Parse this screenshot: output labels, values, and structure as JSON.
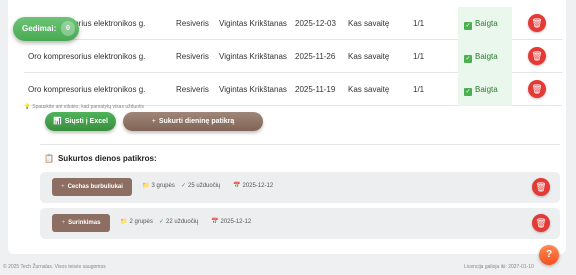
{
  "tasks": [
    {
      "component": "Oro kompresorius elektronikos g.",
      "type": "Resiveris",
      "person": "Vigintas Krikštanas",
      "date": "2025-12-03",
      "frequency": "Kas savaitę",
      "progress": "1/1",
      "status": "Baigta"
    },
    {
      "component": "Oro kompresorius elektronikos g.",
      "type": "Resiveris",
      "person": "Vigintas Krikštanas",
      "date": "2025-11-26",
      "frequency": "Kas savaitę",
      "progress": "1/1",
      "status": "Baigta"
    },
    {
      "component": "Oro kompresorius elektronikos g.",
      "type": "Resiveris",
      "person": "Vigintas Krikštanas",
      "date": "2025-11-19",
      "frequency": "Kas savaitę",
      "progress": "1/1",
      "status": "Baigta"
    }
  ],
  "gedimai": {
    "label": "Gedimai:",
    "count": "0"
  },
  "hint": "Spauskite ant eilutės, kad pamatytų visas užduotis",
  "actions": {
    "excel_label": "Siųsti į Excel",
    "create_check_label": "Sukurti dieninę patikrą"
  },
  "section_title": "Sukurtos dienos patikros:",
  "daily_checks": [
    {
      "name": "Cechas burbuliukai",
      "groups": "3 grupės",
      "tasks": "25 užduočių",
      "date": "2025-12-12"
    },
    {
      "name": "Surinkimas",
      "groups": "2 grupės",
      "tasks": "22 užduočių",
      "date": "2025-12-12"
    }
  ],
  "footer": {
    "copyright": "© 2025 Tech Žurnalas. Visos teisės saugomos",
    "license": "Licencija galioja iki: 2027-01-10"
  },
  "help_label": "?",
  "colors": {
    "success": "#4caf50",
    "danger": "#e53935",
    "brown": "#8d6e63",
    "help": "#f4511e"
  }
}
